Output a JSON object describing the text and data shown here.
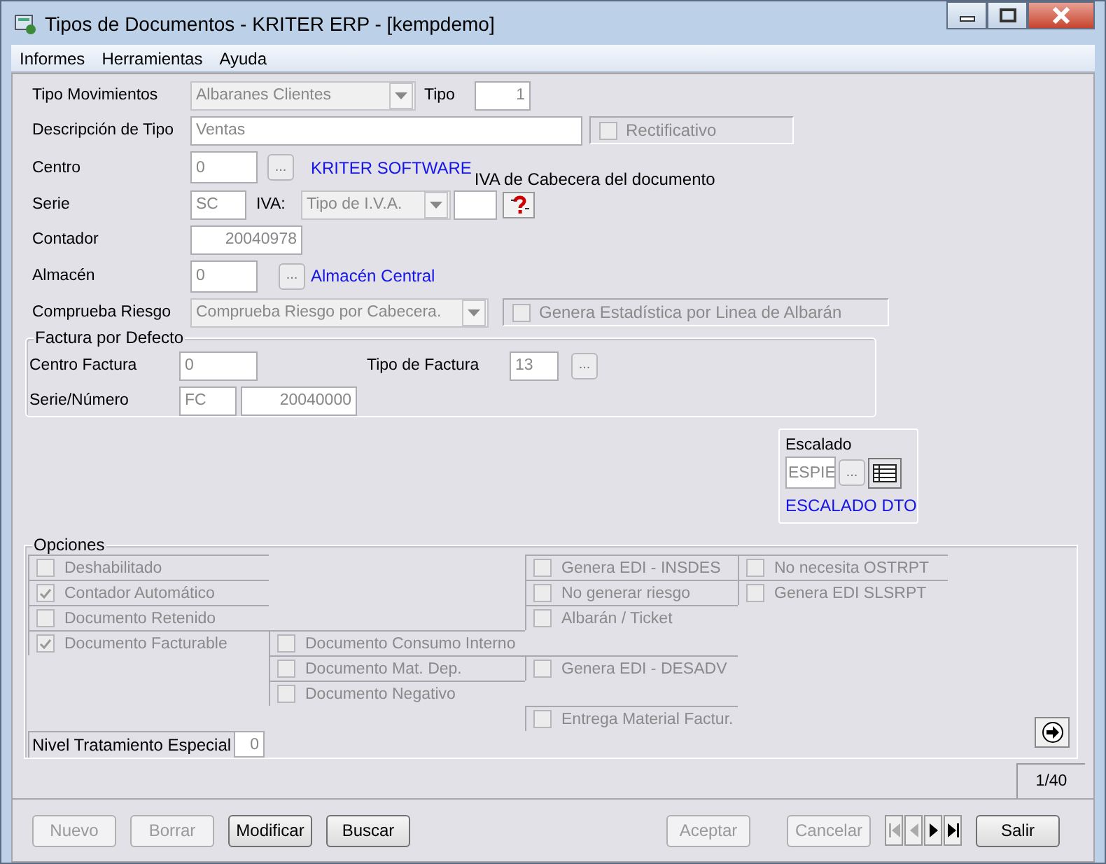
{
  "window": {
    "title": "Tipos de Documentos - KRITER ERP - [kempdemo]"
  },
  "menu": [
    "Informes",
    "Herramientas",
    "Ayuda"
  ],
  "form": {
    "tipo_movimientos": {
      "label": "Tipo Movimientos",
      "value": "Albaranes Clientes"
    },
    "tipo": {
      "label": "Tipo",
      "value": "1"
    },
    "descripcion": {
      "label": "Descripción de Tipo",
      "value": "Ventas"
    },
    "rectificativo": {
      "label": "Rectificativo",
      "checked": false
    },
    "centro": {
      "label": "Centro",
      "value": "0",
      "button": "...",
      "name": "KRITER SOFTWARE"
    },
    "iva_cabecera_label": "IVA de Cabecera del documento",
    "serie": {
      "label": "Serie",
      "value": "SC"
    },
    "iva": {
      "label": "IVA:",
      "value": "Tipo de I.V.A."
    },
    "contador": {
      "label": "Contador",
      "value": "20040978"
    },
    "almacen": {
      "label": "Almacén",
      "value": "0",
      "button": "...",
      "name": "Almacén Central"
    },
    "comprueba_riesgo": {
      "label": "Comprueba Riesgo",
      "value": "Comprueba Riesgo por Cabecera."
    },
    "genera_estadistica": {
      "label": "Genera Estadística por Linea de Albarán",
      "checked": false
    }
  },
  "factura_por_defecto": {
    "title": "Factura por Defecto",
    "centro_factura": {
      "label": "Centro Factura",
      "value": "0"
    },
    "tipo_factura": {
      "label": "Tipo de Factura",
      "value": "13",
      "button": "..."
    },
    "serie_numero": {
      "label": "Serie/Número",
      "serie": "FC",
      "numero": "20040000"
    }
  },
  "escalado": {
    "title": "Escalado",
    "value": "ESPIE",
    "button": "...",
    "link": "ESCALADO DTO"
  },
  "opciones": {
    "title": "Opciones",
    "columns": [
      [
        {
          "label": "Deshabilitado",
          "checked": false
        },
        {
          "label": "Contador Automático",
          "checked": true
        },
        {
          "label": "Documento Retenido",
          "checked": false
        },
        {
          "label": "Documento Facturable",
          "checked": true
        }
      ],
      [
        {
          "label": "Documento Consumo Interno",
          "checked": false
        },
        {
          "label": "Documento Mat. Dep.",
          "checked": false
        },
        {
          "label": "Documento Negativo",
          "checked": false
        }
      ],
      [
        {
          "label": "Genera EDI - INSDES",
          "checked": false
        },
        {
          "label": "No generar riesgo",
          "checked": false
        },
        {
          "label": "Albarán / Ticket",
          "checked": false
        },
        {
          "label": "Genera EDI - DESADV",
          "checked": false
        },
        {
          "label": "Entrega Material Factur.",
          "checked": false
        }
      ],
      [
        {
          "label": "No necesita OSTRPT",
          "checked": false
        },
        {
          "label": "Genera EDI SLSRPT",
          "checked": false
        }
      ]
    ],
    "nivel": {
      "label": "Nivel Tratamiento Especial",
      "value": "0"
    }
  },
  "record_counter": "1/40",
  "left_buttons": [
    {
      "label": "Nuevo",
      "disabled": true
    },
    {
      "label": "Borrar",
      "disabled": true
    },
    {
      "label": "Modificar",
      "disabled": false
    },
    {
      "label": "Buscar",
      "disabled": false
    }
  ],
  "right_buttons": [
    {
      "label": "Aceptar",
      "disabled": true
    },
    {
      "label": "Cancelar",
      "disabled": true
    }
  ],
  "navigation": [
    {
      "kind": "first",
      "disabled": true
    },
    {
      "kind": "prev",
      "disabled": true
    },
    {
      "kind": "next",
      "disabled": false
    },
    {
      "kind": "last",
      "disabled": false
    }
  ],
  "exit_button": {
    "label": "Salir"
  }
}
